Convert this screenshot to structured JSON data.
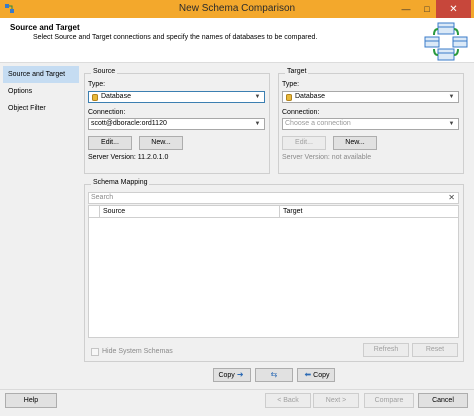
{
  "window": {
    "title": "New Schema Comparison"
  },
  "header": {
    "title": "Source and Target",
    "subtitle": "Select Source and Target connections and specify the names of databases to be compared."
  },
  "sidebar": {
    "items": [
      {
        "label": "Source and Target",
        "active": true
      },
      {
        "label": "Options",
        "active": false
      },
      {
        "label": "Object Filter",
        "active": false
      }
    ]
  },
  "source": {
    "group_label": "Source",
    "type_label": "Type:",
    "type_value": "Database",
    "connection_label": "Connection:",
    "connection_value": "scott@dboracle:ord1120",
    "edit_label": "Edit...",
    "new_label": "New...",
    "server_version": "Server Version: 11.2.0.1.0"
  },
  "target": {
    "group_label": "Target",
    "type_label": "Type:",
    "type_value": "Database",
    "connection_label": "Connection:",
    "connection_placeholder": "Choose a connection",
    "edit_label": "Edit...",
    "new_label": "New...",
    "server_version": "Server Version: not available"
  },
  "schema_mapping": {
    "group_label": "Schema Mapping",
    "search_placeholder": "Search",
    "columns": [
      "Source",
      "Target"
    ],
    "hide_system_label": "Hide System Schemas",
    "refresh_label": "Refresh",
    "reset_label": "Reset"
  },
  "copy_bar": {
    "copy_right_label": "Copy",
    "copy_left_label": "Copy"
  },
  "footer": {
    "help_label": "Help",
    "back_label": "< Back",
    "next_label": "Next >",
    "compare_label": "Compare",
    "cancel_label": "Cancel"
  },
  "colors": {
    "titlebar": "#f3a82c",
    "close": "#c7473b",
    "nav_active": "#c5dcf2"
  }
}
